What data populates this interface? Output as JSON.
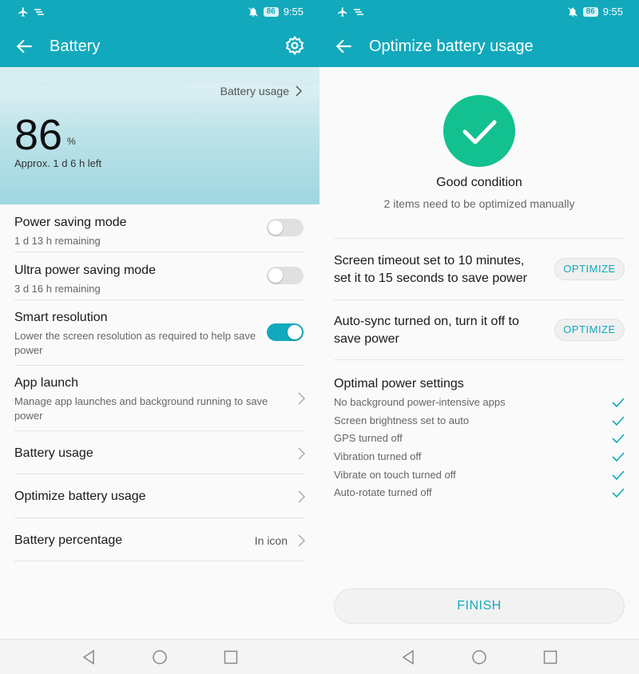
{
  "colors": {
    "accent": "#12a9bd",
    "success": "#12c18f"
  },
  "status_bar": {
    "battery_level": "86",
    "time": "9:55"
  },
  "left": {
    "title": "Battery",
    "hero": {
      "usage_link": "Battery usage",
      "percent": "86",
      "percent_sign": "%",
      "remaining": "Approx. 1 d 6 h left"
    },
    "items": [
      {
        "title": "Power saving mode",
        "subtitle": "1 d 13 h remaining",
        "toggle": "off"
      },
      {
        "title": "Ultra power saving mode",
        "subtitle": "3 d 16 h remaining",
        "toggle": "off"
      },
      {
        "title": "Smart resolution",
        "subtitle": "Lower the screen resolution as required to help save power",
        "toggle": "on"
      },
      {
        "title": "App launch",
        "subtitle": "Manage app launches and background running to save power"
      },
      {
        "title": "Battery usage"
      },
      {
        "title": "Optimize battery usage"
      },
      {
        "title": "Battery percentage",
        "value": "In icon"
      }
    ]
  },
  "right": {
    "title": "Optimize battery usage",
    "status_title": "Good condition",
    "status_subtitle": "2 items need to be optimized manually",
    "optimize_items": [
      {
        "text": "Screen timeout set to 10 minutes, set it to 15 seconds to save power",
        "button": "OPTIMIZE"
      },
      {
        "text": "Auto-sync turned on, turn it off to save power",
        "button": "OPTIMIZE"
      }
    ],
    "optimal_heading": "Optimal power settings",
    "optimal_items": [
      "No background power-intensive apps",
      "Screen brightness set to auto",
      "GPS turned off",
      "Vibration turned off",
      "Vibrate on touch turned off",
      "Auto-rotate turned off"
    ],
    "finish_button": "FINISH"
  }
}
